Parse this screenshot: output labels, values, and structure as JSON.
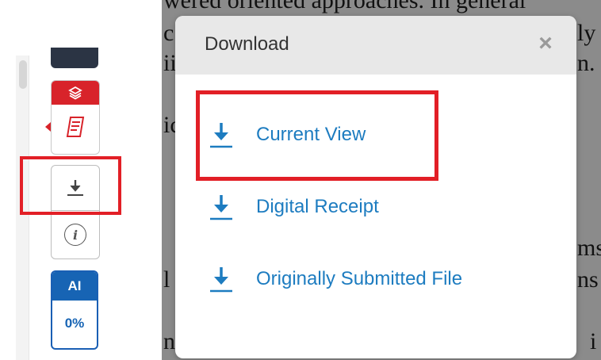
{
  "dialog": {
    "title": "Download",
    "close_icon": "×",
    "options": [
      {
        "label": "Current View",
        "icon": "download-icon"
      },
      {
        "label": "Digital Receipt",
        "icon": "download-icon"
      },
      {
        "label": "Originally Submitted File",
        "icon": "download-icon"
      }
    ]
  },
  "sidebar": {
    "ai_label": "AI",
    "ai_value": "0%",
    "info_glyph": "i"
  },
  "document_fragments": {
    "line1": "wered oriented approaches. In general",
    "line2_left": "c",
    "line2_right": "ly",
    "line3_left": "ii",
    "line3_right": "n.",
    "line4_left": "ic",
    "line5_right": "ms",
    "line6_left": "l",
    "line6_right": "ns",
    "line7_left": "n",
    "line7_right": "i"
  },
  "colors": {
    "accent_blue": "#1d7cc0",
    "highlight_red": "#e21f26",
    "layers_red": "#d8232a",
    "ai_blue": "#1764b4"
  }
}
